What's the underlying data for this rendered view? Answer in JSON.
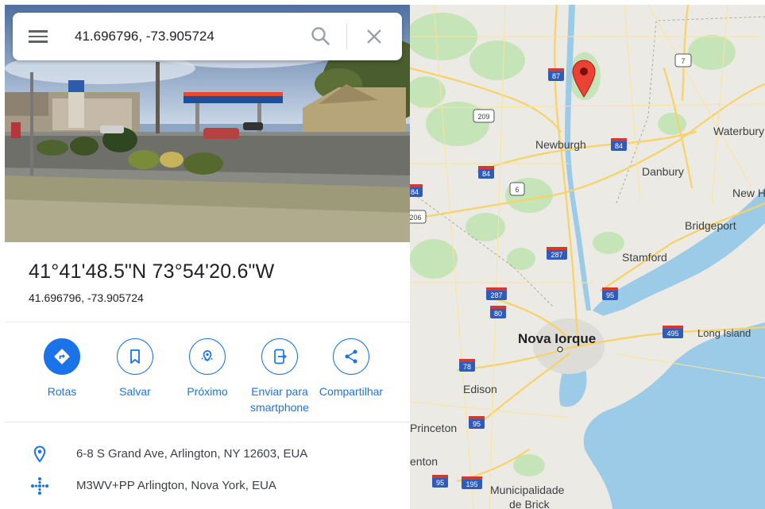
{
  "search": {
    "value": "41.696796, -73.905724",
    "menu_icon": "menu-icon",
    "search_icon": "search-icon",
    "close_icon": "close-icon"
  },
  "place": {
    "title": "41°41'48.5\"N 73°54'20.6\"W",
    "subtitle": "41.696796, -73.905724"
  },
  "actions": [
    {
      "label": "Rotas",
      "icon": "directions-icon"
    },
    {
      "label": "Salvar",
      "icon": "bookmark-icon"
    },
    {
      "label": "Próximo",
      "icon": "nearby-icon"
    },
    {
      "label": "Enviar para smartphone",
      "icon": "send-to-phone-icon"
    },
    {
      "label": "Compartilhar",
      "icon": "share-icon"
    }
  ],
  "details": [
    {
      "text": "6-8 S Grand Ave, Arlington, NY 12603, EUA",
      "icon": "location-pin-icon"
    },
    {
      "text": "M3WV+PP Arlington, Nova York, EUA",
      "icon": "plus-code-icon"
    }
  ],
  "map": {
    "place_labels": [
      "Newburgh",
      "Danbury",
      "Waterbury",
      "New H",
      "Bridgeport",
      "Stamford",
      "Nova Iorque",
      "Long Island",
      "Edison",
      "Princeton",
      "enton",
      "Municipalidade",
      "de Brick"
    ],
    "route_shields": [
      "87",
      "7",
      "209",
      "84",
      "84",
      "84",
      "6",
      "84",
      "206",
      "287",
      "287",
      "95",
      "80",
      "495",
      "78",
      "95",
      "95",
      "195"
    ]
  },
  "colors": {
    "accent": "#1a73e8",
    "water": "#9ccbe8",
    "pin": "#ea4335",
    "land": "#eceae4",
    "park": "#c5e4b8",
    "road": "#f8d264"
  }
}
